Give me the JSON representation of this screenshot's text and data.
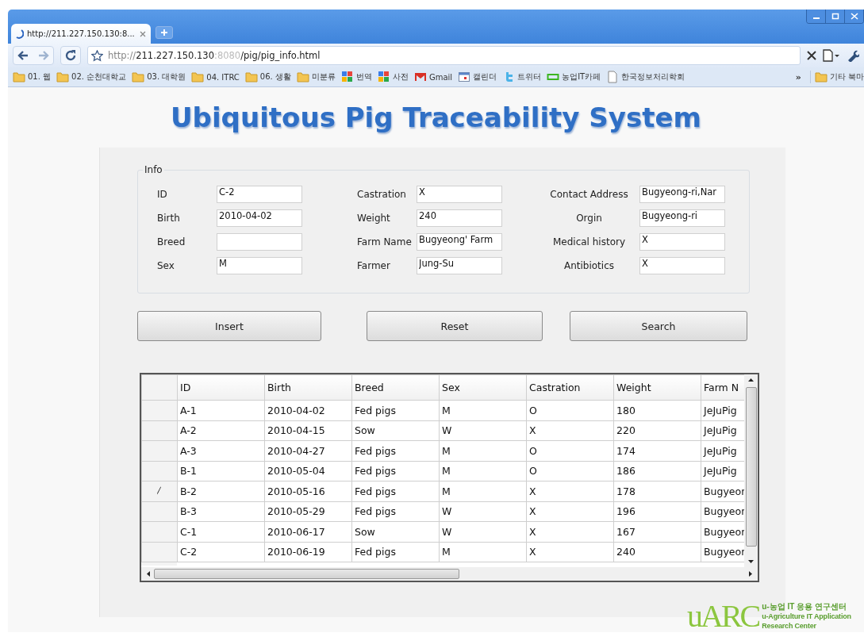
{
  "browser": {
    "tab": {
      "title": "http://211.227.150.130:8...",
      "selected": true
    },
    "url": {
      "scheme": "http://",
      "host": "211.227.150.130",
      "port": ":8080",
      "path": "/pig/pig_info.html"
    },
    "bookmarks": [
      {
        "label": "01. 웹",
        "kind": "folder"
      },
      {
        "label": "02. 순천대학교",
        "kind": "folder"
      },
      {
        "label": "03. 대학원",
        "kind": "folder"
      },
      {
        "label": "04. ITRC",
        "kind": "folder"
      },
      {
        "label": "06. 생활",
        "kind": "folder"
      },
      {
        "label": "미분류",
        "kind": "folder"
      },
      {
        "label": "번역",
        "kind": "google"
      },
      {
        "label": "사전",
        "kind": "google"
      },
      {
        "label": "Gmail",
        "kind": "mail"
      },
      {
        "label": "캘린더",
        "kind": "calendar"
      },
      {
        "label": "트위터",
        "kind": "twitter"
      },
      {
        "label": "농업IT카페",
        "kind": "cafe"
      },
      {
        "label": "한국정보처리학회",
        "kind": "page"
      }
    ],
    "more_bookmarks": "»",
    "other_bookmarks": "기타 북마"
  },
  "page": {
    "title": "Ubiquitous Pig Traceability System",
    "info": {
      "legend": "Info",
      "columns": [
        [
          {
            "label": "ID",
            "value": "C-2"
          },
          {
            "label": "Birth",
            "value": "2010-04-02"
          },
          {
            "label": "Breed"
          },
          {
            "label": "Sex",
            "value": "M"
          }
        ],
        [
          {
            "label": "Castration",
            "value": "X"
          },
          {
            "label": "Weight",
            "value": "240"
          },
          {
            "label": "Farm Name",
            "value": "Bugyeong' Farm"
          },
          {
            "label": "Farmer",
            "value": "Jung-Su"
          }
        ],
        [
          {
            "label": "Contact Address",
            "value": "Bugyeong-ri,Nar"
          },
          {
            "label": "Orgin",
            "value": "Bugyeong-ri"
          },
          {
            "label": "Medical history",
            "value": "X"
          },
          {
            "label": "Antibiotics",
            "value": "X"
          }
        ]
      ]
    },
    "buttons": [
      "Insert",
      "Reset",
      "Search"
    ],
    "table": {
      "columns": [
        "ID",
        "Birth",
        "Breed",
        "Sex",
        "Castration",
        "Weight",
        "Farm N"
      ],
      "rows": [
        {
          "cells": [
            "A-1",
            "2010-04-02",
            "Fed pigs",
            "M",
            "O",
            "180",
            "JeJuPig"
          ],
          "editing": false
        },
        {
          "cells": [
            "A-2",
            "2010-04-15",
            "Sow",
            "W",
            "X",
            "220",
            "JeJuPig"
          ],
          "editing": false
        },
        {
          "cells": [
            "A-3",
            "2010-04-27",
            "Fed pigs",
            "M",
            "O",
            "174",
            "JeJuPig"
          ],
          "editing": false
        },
        {
          "cells": [
            "B-1",
            "2010-05-04",
            "Fed pigs",
            "M",
            "O",
            "186",
            "JeJuPig"
          ],
          "editing": false
        },
        {
          "cells": [
            "B-2",
            "2010-05-16",
            "Fed pigs",
            "M",
            "X",
            "178",
            "Bugyeor"
          ],
          "editing": true
        },
        {
          "cells": [
            "B-3",
            "2010-05-29",
            "Fed pigs",
            "W",
            "X",
            "196",
            "Bugyeor"
          ],
          "editing": false
        },
        {
          "cells": [
            "C-1",
            "2010-06-17",
            "Sow",
            "W",
            "X",
            "167",
            "Bugyeor"
          ],
          "editing": false
        },
        {
          "cells": [
            "C-2",
            "2010-06-19",
            "Fed pigs",
            "M",
            "X",
            "240",
            "Bugyeor"
          ],
          "editing": false
        }
      ]
    },
    "logo": {
      "mark": "uARC",
      "line_1": "u-농업 IT 응용 연구센터",
      "line_2": "u-Agriculture IT Application",
      "line_3": "Research Center"
    }
  }
}
